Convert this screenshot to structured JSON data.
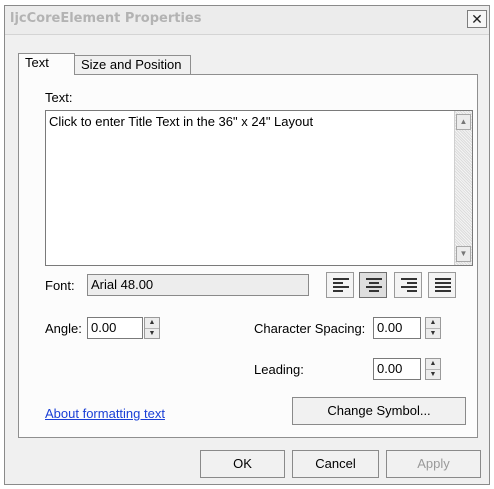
{
  "window": {
    "title": "ljcCoreElement Properties",
    "close_glyph": "✕"
  },
  "tabs": [
    {
      "label": "Text",
      "active": true
    },
    {
      "label": "Size and Position",
      "active": false
    }
  ],
  "text_section": {
    "label": "Text:",
    "value": "Click to enter Title Text in the 36\" x 24\" Layout"
  },
  "font": {
    "label": "Font:",
    "value": "Arial 48.00"
  },
  "alignment": {
    "options": [
      "left",
      "center",
      "right",
      "justify"
    ],
    "selected": "center"
  },
  "angle": {
    "label": "Angle:",
    "value": "0.00"
  },
  "character_spacing": {
    "label": "Character Spacing:",
    "value": "0.00"
  },
  "leading": {
    "label": "Leading:",
    "value": "0.00"
  },
  "help_link": "About formatting text",
  "change_symbol_button": "Change Symbol...",
  "footer": {
    "ok": "OK",
    "cancel": "Cancel",
    "apply": "Apply"
  }
}
